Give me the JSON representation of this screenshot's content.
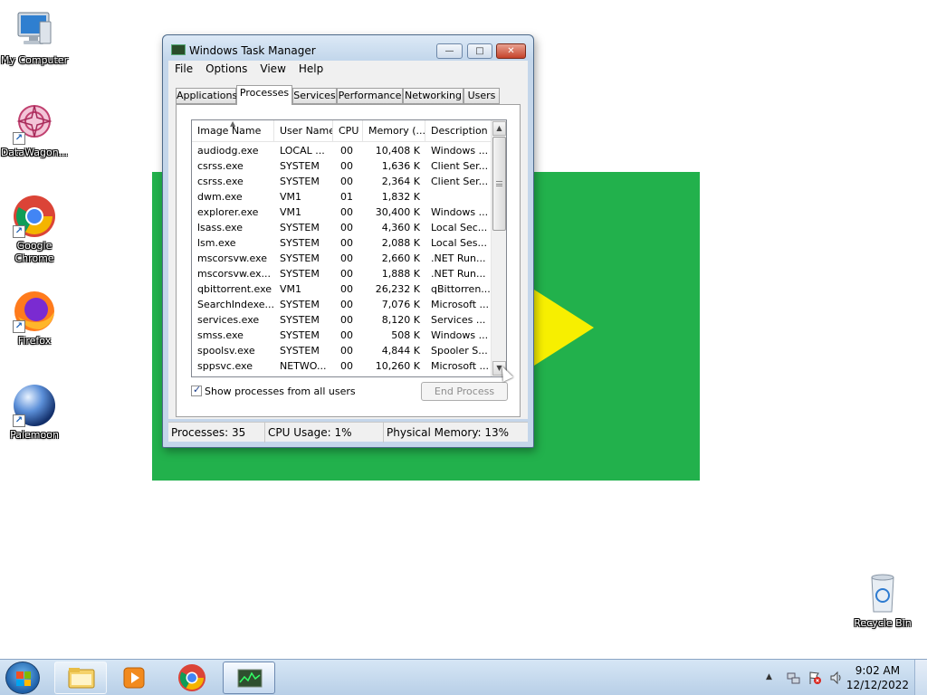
{
  "desktop": {
    "icons": [
      {
        "label": "My Computer",
        "icon": "computer-icon"
      },
      {
        "label": "DataWagon...",
        "icon": "datawagon-icon"
      },
      {
        "label": "Google Chrome",
        "icon": "chrome-icon"
      },
      {
        "label": "Firefox",
        "icon": "firefox-icon"
      },
      {
        "label": "Palemoon",
        "icon": "palemoon-icon"
      },
      {
        "label": "Recycle Bin",
        "icon": "recycle-bin-icon"
      }
    ],
    "shortcut_glyph": "↗"
  },
  "window": {
    "title": "Windows Task Manager",
    "controls": {
      "minimize": "—",
      "maximize": "□",
      "close": "✕"
    },
    "menu": [
      "File",
      "Options",
      "View",
      "Help"
    ],
    "tabs": [
      "Applications",
      "Processes",
      "Services",
      "Performance",
      "Networking",
      "Users"
    ],
    "active_tab": "Processes",
    "columns": [
      "Image Name",
      "User Name",
      "CPU",
      "Memory (...",
      "Description"
    ],
    "sort_indicator": "▲",
    "processes": [
      [
        "audiodg.exe",
        "LOCAL ...",
        "00",
        "10,408 K",
        "Windows ..."
      ],
      [
        "csrss.exe",
        "SYSTEM",
        "00",
        "1,636 K",
        "Client Ser..."
      ],
      [
        "csrss.exe",
        "SYSTEM",
        "00",
        "2,364 K",
        "Client Ser..."
      ],
      [
        "dwm.exe",
        "VM1",
        "01",
        "1,832 K",
        ""
      ],
      [
        "explorer.exe",
        "VM1",
        "00",
        "30,400 K",
        "Windows ..."
      ],
      [
        "lsass.exe",
        "SYSTEM",
        "00",
        "4,360 K",
        "Local Sec..."
      ],
      [
        "lsm.exe",
        "SYSTEM",
        "00",
        "2,088 K",
        "Local Ses..."
      ],
      [
        "mscorsvw.exe",
        "SYSTEM",
        "00",
        "2,660 K",
        ".NET Run..."
      ],
      [
        "mscorsvw.ex...",
        "SYSTEM",
        "00",
        "1,888 K",
        ".NET Run..."
      ],
      [
        "qbittorrent.exe",
        "VM1",
        "00",
        "26,232 K",
        "qBittorren..."
      ],
      [
        "SearchIndexe...",
        "SYSTEM",
        "00",
        "7,076 K",
        "Microsoft ..."
      ],
      [
        "services.exe",
        "SYSTEM",
        "00",
        "8,120 K",
        "Services ..."
      ],
      [
        "smss.exe",
        "SYSTEM",
        "00",
        "508 K",
        "Windows ..."
      ],
      [
        "spoolsv.exe",
        "SYSTEM",
        "00",
        "4,844 K",
        "Spooler S..."
      ],
      [
        "sppsvc.exe",
        "NETWO...",
        "00",
        "10,260 K",
        "Microsoft ..."
      ]
    ],
    "scroll": {
      "up": "▲",
      "down": "▼"
    },
    "show_all_label": "Show processes from all users",
    "show_all_checked": true,
    "end_process_label": "End Process",
    "status": {
      "processes": "Processes: 35",
      "cpu": "CPU Usage: 1%",
      "memory": "Physical Memory: 13%"
    }
  },
  "taskbar": {
    "tray_chevron": "▲",
    "time": "9:02 AM",
    "date": "12/12/2022"
  },
  "colors": {
    "green_bg": "#22b14c",
    "yellow_arrow": "#f7ef00"
  }
}
